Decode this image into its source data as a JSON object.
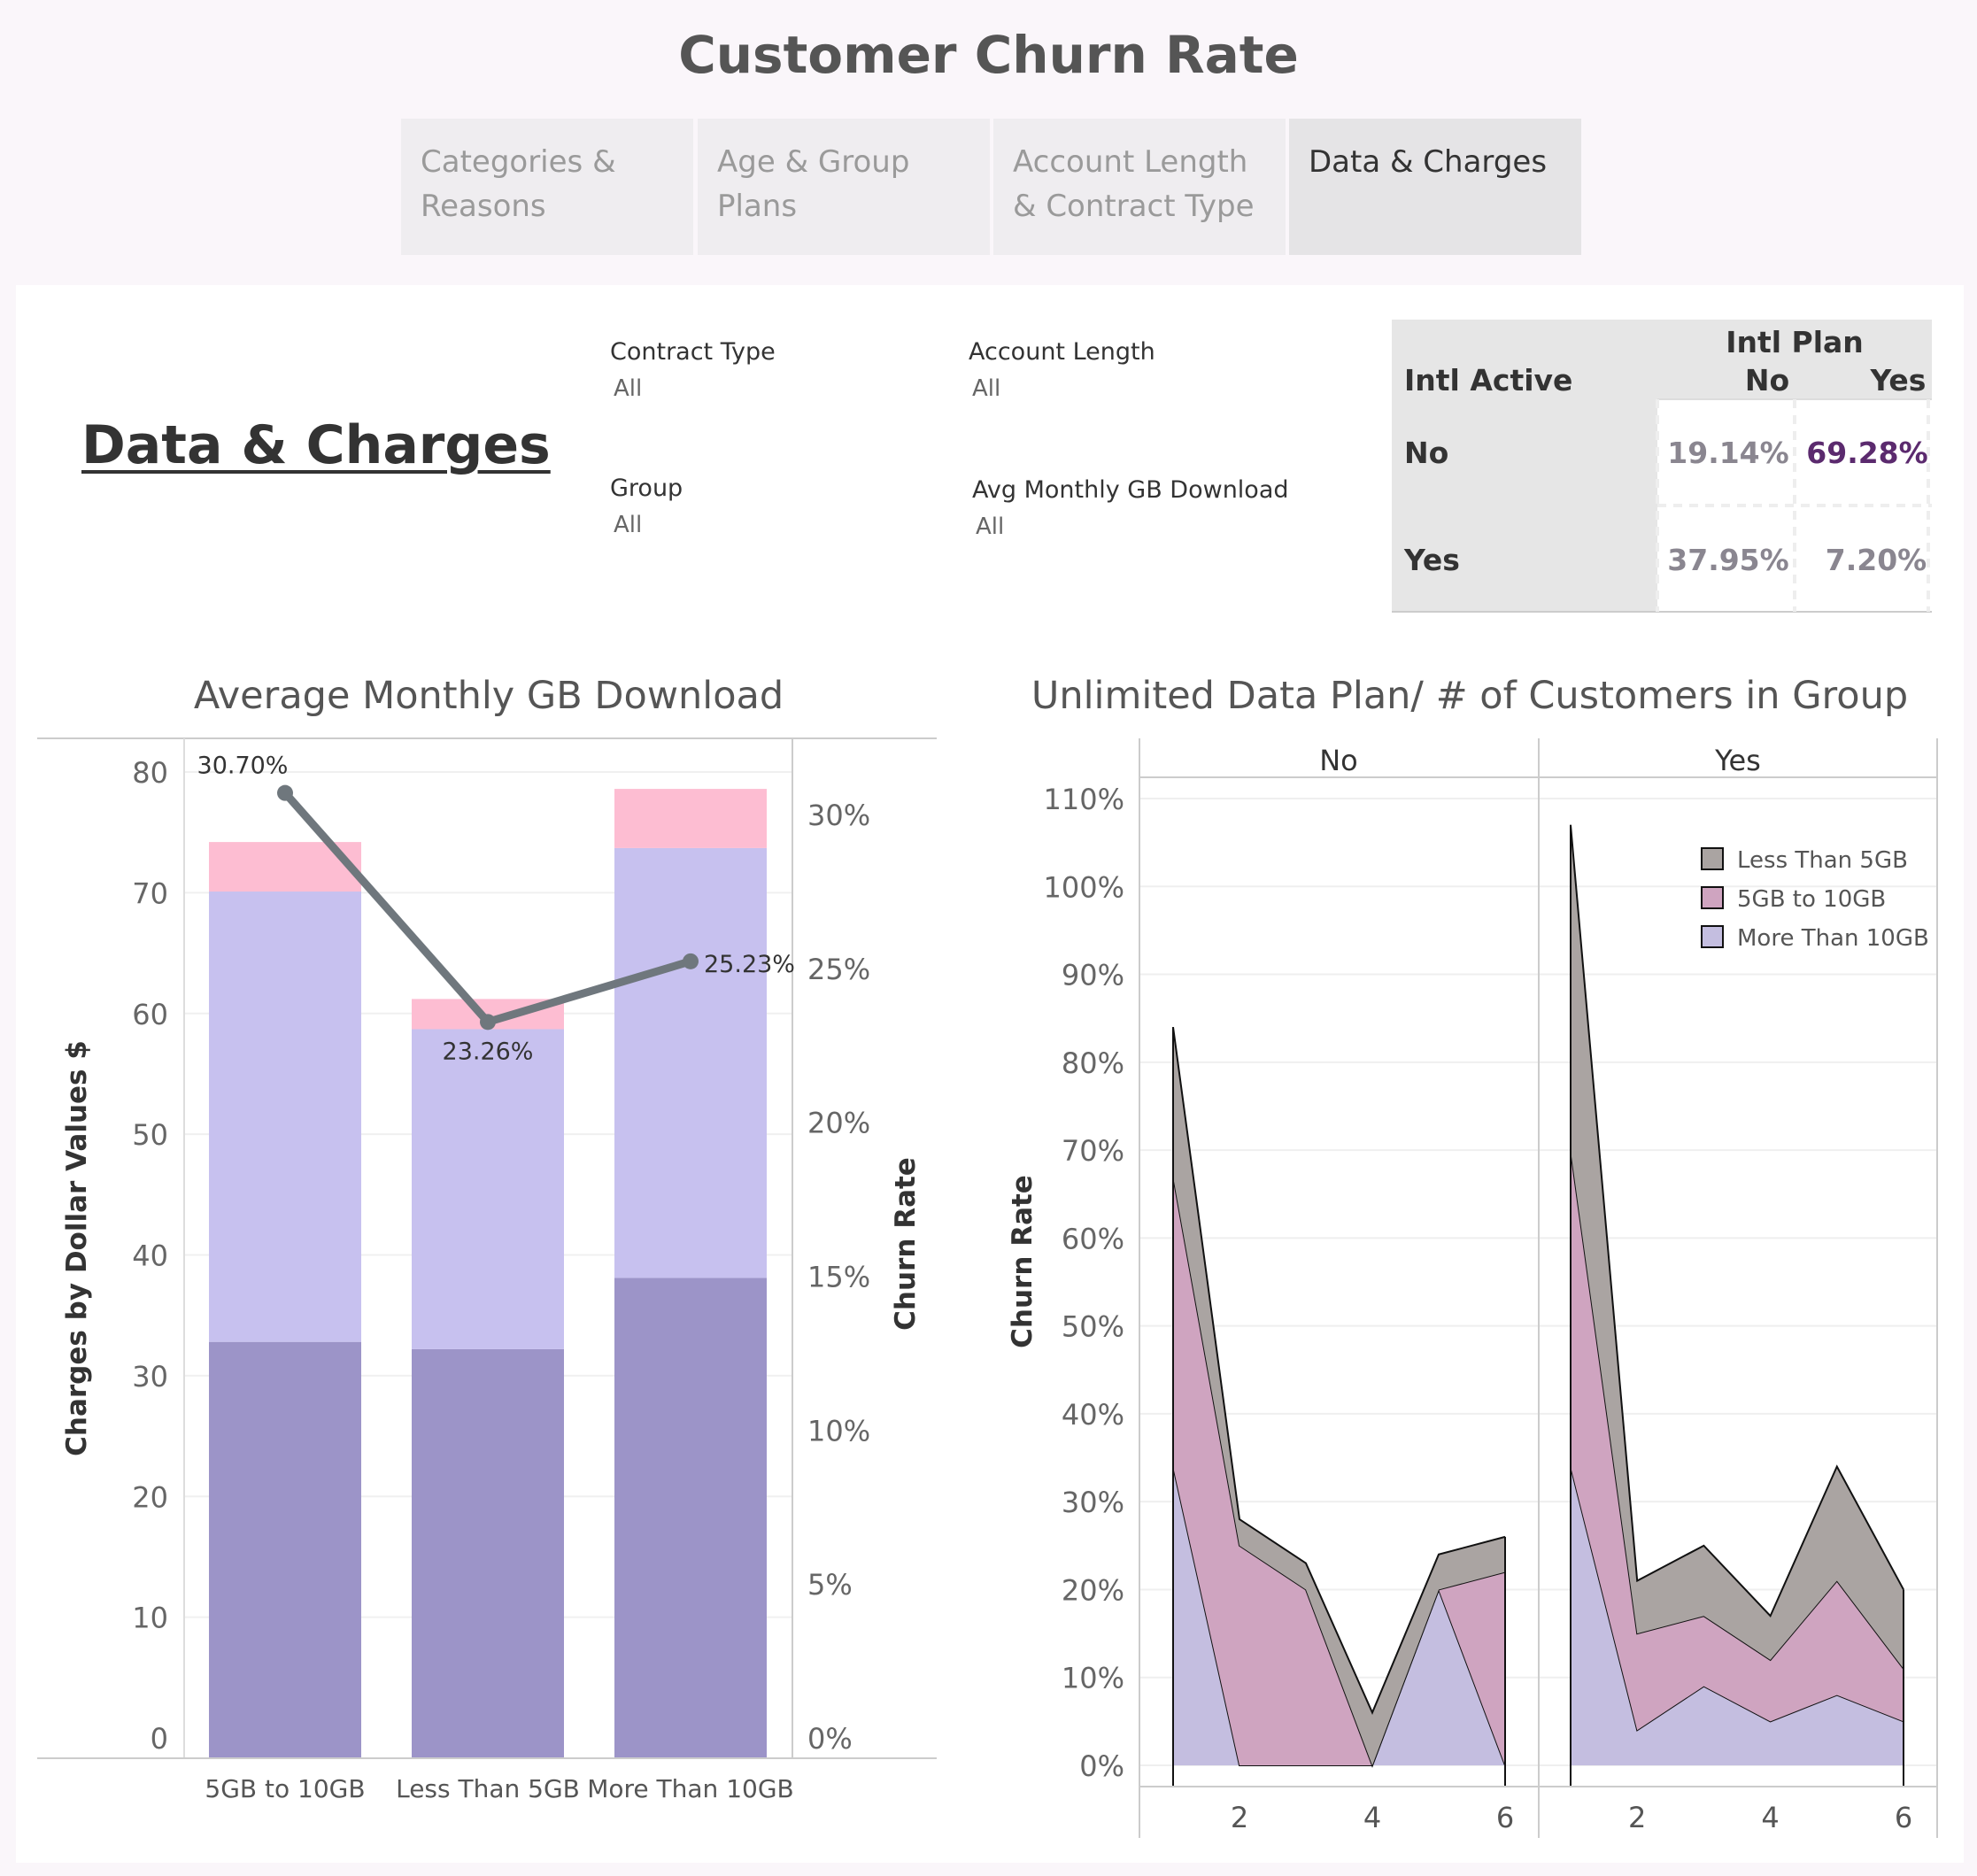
{
  "dashboard": {
    "title": "Customer Churn Rate",
    "tabs": [
      {
        "label": "Categories &\nReasons",
        "active": false
      },
      {
        "label": "Age & Group\nPlans",
        "active": false
      },
      {
        "label": "Account Length\n& Contract Type",
        "active": false
      },
      {
        "label": "Data & Charges",
        "active": true
      }
    ],
    "section_title": "Data & Charges"
  },
  "filters": {
    "contract_type": {
      "label": "Contract Type",
      "value": "All"
    },
    "account_length": {
      "label": "Account Length",
      "value": "All"
    },
    "group": {
      "label": "Group",
      "value": "All"
    },
    "avg_monthly_gb": {
      "label": "Avg Monthly GB Download",
      "value": "All"
    }
  },
  "intl_table": {
    "column_group": "Intl Plan",
    "row_header": "Intl Active",
    "columns": [
      "No",
      "Yes"
    ],
    "rows": [
      {
        "label": "No",
        "values": [
          "19.14%",
          "69.28%"
        ]
      },
      {
        "label": "Yes",
        "values": [
          "37.95%",
          "7.20%"
        ]
      }
    ],
    "highlight_color": "#5b2a6e",
    "value_color": "#8a8690"
  },
  "chart_data": [
    {
      "type": "bar",
      "title": "Average Monthly GB Download",
      "categories": [
        "5GB to 10GB",
        "Less Than 5GB",
        "More Than 10GB"
      ],
      "ylabel": "Charges by Dollar Values $",
      "ylabel2": "Churn Rate",
      "ylim": [
        0,
        80
      ],
      "y2lim": [
        0,
        0.3
      ],
      "yticks": [
        "0",
        "10",
        "20",
        "30",
        "40",
        "50",
        "60",
        "70",
        "80"
      ],
      "y2ticks": [
        "0%",
        "5%",
        "10%",
        "15%",
        "20%",
        "25%",
        "30%"
      ],
      "stacked": true,
      "series": [
        {
          "values": [
            32.8,
            32.2,
            38.1
          ],
          "color": "#9c94c8"
        },
        {
          "values": [
            37.3,
            26.5,
            35.6
          ],
          "color": "#c7c1ef"
        },
        {
          "values": [
            4.1,
            2.5,
            4.9
          ],
          "color": "#fdbdd2"
        }
      ],
      "line": {
        "values": [
          0.307,
          0.2326,
          0.2523
        ],
        "labels": [
          "30.70%",
          "23.26%",
          "25.23%"
        ],
        "color": "#6f777d"
      },
      "grid": true
    },
    {
      "type": "area",
      "title": "Unlimited Data Plan/ # of Customers in Group",
      "ylabel": "Churn Rate",
      "ylim": [
        0,
        1.1
      ],
      "yticks": [
        "0%",
        "10%",
        "20%",
        "30%",
        "40%",
        "50%",
        "60%",
        "70%",
        "80%",
        "90%",
        "100%",
        "110%"
      ],
      "xticks": [
        "2",
        "4",
        "6"
      ],
      "panels": [
        "No",
        "Yes"
      ],
      "legend": {
        "placement": "top-right",
        "items": [
          {
            "label": "Less Than 5GB",
            "color": "#aaa4a2"
          },
          {
            "label": "5GB to 10GB",
            "color": "#cfa4c0"
          },
          {
            "label": "More Than 10GB",
            "color": "#c4bee0"
          }
        ]
      },
      "stacked": true,
      "x": [
        1,
        2,
        3,
        4,
        5,
        6
      ],
      "series_by_panel": {
        "No": [
          {
            "name": "More Than 10GB",
            "values": [
              0.34,
              0.0,
              0.0,
              0.0,
              0.2,
              0.0
            ]
          },
          {
            "name": "5GB to 10GB",
            "values": [
              0.33,
              0.25,
              0.2,
              0.0,
              0.0,
              0.22
            ]
          },
          {
            "name": "Less Than 5GB",
            "values": [
              0.17,
              0.03,
              0.03,
              0.06,
              0.04,
              0.04
            ]
          }
        ],
        "Yes": [
          {
            "name": "More Than 10GB",
            "values": [
              0.34,
              0.04,
              0.09,
              0.05,
              0.08,
              0.05
            ]
          },
          {
            "name": "5GB to 10GB",
            "values": [
              0.36,
              0.11,
              0.08,
              0.07,
              0.13,
              0.06
            ]
          },
          {
            "name": "Less Than 5GB",
            "values": [
              0.37,
              0.06,
              0.08,
              0.05,
              0.13,
              0.09
            ]
          }
        ]
      },
      "grid": true
    }
  ]
}
